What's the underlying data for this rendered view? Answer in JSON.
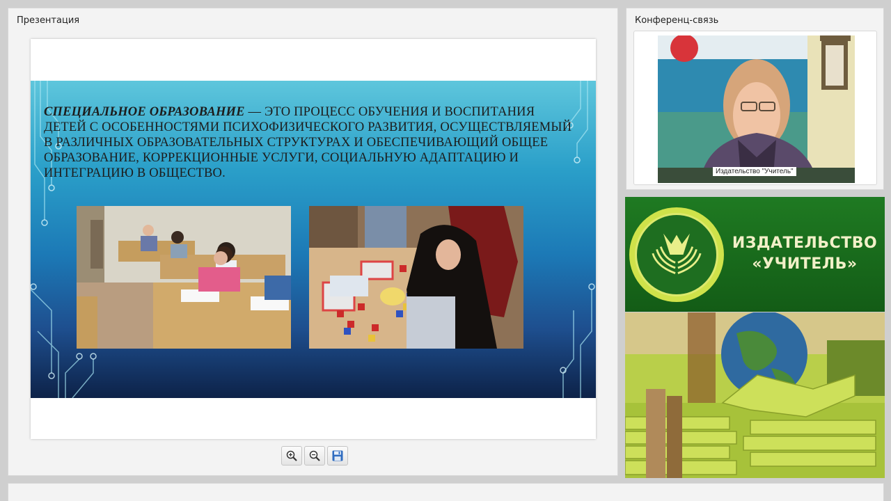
{
  "presentation": {
    "title": "Презентация",
    "slide": {
      "term": "Специальное образование",
      "definition": " — это процесс обучения и воспитания детей с особенностями психофизического развития, осуществляемый в различных образовательных структурах и обеспечивающий общее образование, коррекционные услуги, социальную адаптацию и интеграцию в общество."
    },
    "toolbar": {
      "zoom_in_icon": "zoom-in-icon",
      "zoom_out_icon": "zoom-out-icon",
      "save_icon": "save-icon"
    }
  },
  "conference": {
    "title": "Конференц-связь",
    "video_caption": "Издательство \"Учитель\""
  },
  "banner": {
    "line1": "ИЗДАТЕЛЬСТВО",
    "line2": "«УЧИТЕЛЬ»"
  },
  "colors": {
    "slide_top": "#5ec6dc",
    "slide_bottom": "#0d2248",
    "banner_green": "#1f7a22",
    "banner_text": "#f2f0c8"
  }
}
